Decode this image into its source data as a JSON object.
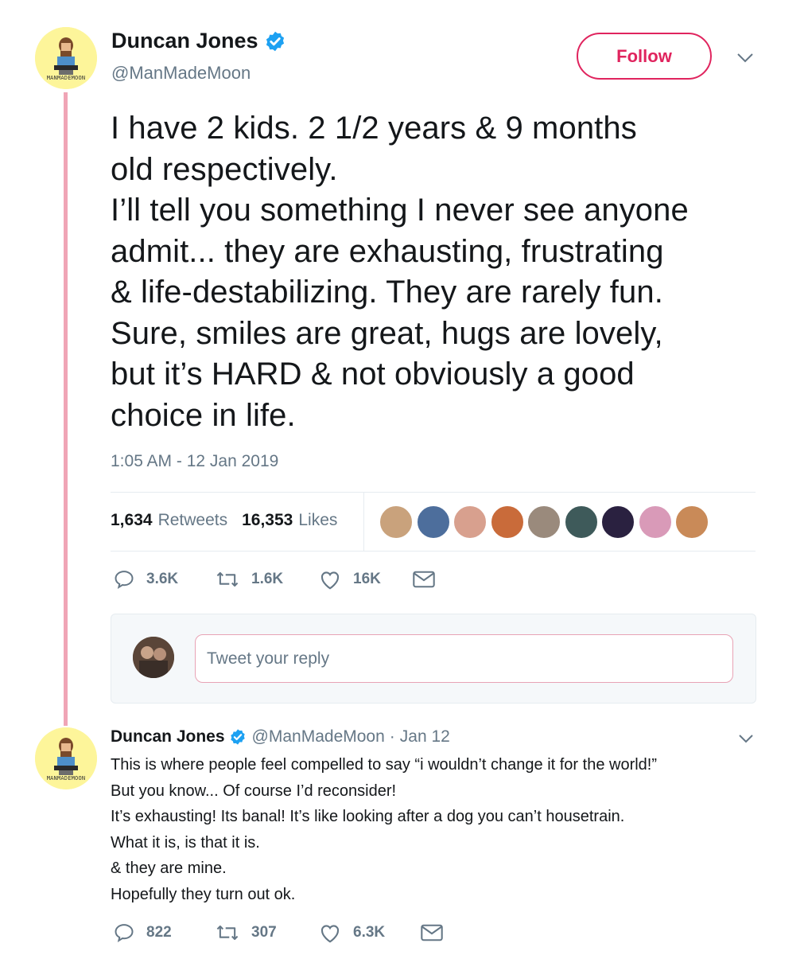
{
  "main_tweet": {
    "author_name": "Duncan Jones",
    "author_handle": "@ManMadeMoon",
    "avatar_caption": "MANMADEMOON",
    "follow_label": "Follow",
    "text": "I have 2 kids.  2 1/2 years & 9 months\nold respectively.\nI’ll tell you something I never see anyone\nadmit... they are exhausting, frustrating\n& life-destabilizing.  They are rarely fun.\nSure, smiles are great, hugs are lovely,\nbut it’s HARD & not obviously a good\nchoice in life.",
    "timestamp": "1:05 AM - 12 Jan 2019",
    "retweets_count": "1,634",
    "retweets_label": "Retweets",
    "likes_count": "16,353",
    "likes_label": "Likes",
    "likers": [
      {
        "name": "liker-1",
        "color": "#c9a27c"
      },
      {
        "name": "liker-2",
        "color": "#4d6e9c"
      },
      {
        "name": "liker-3",
        "color": "#d8a08e"
      },
      {
        "name": "liker-4",
        "color": "#c96b3a"
      },
      {
        "name": "liker-5",
        "color": "#9a8a7c"
      },
      {
        "name": "liker-6",
        "color": "#3e5a5a"
      },
      {
        "name": "liker-7",
        "color": "#2a2140"
      },
      {
        "name": "liker-8",
        "color": "#d99ab8"
      },
      {
        "name": "liker-9",
        "color": "#c98a58"
      }
    ],
    "actions": {
      "replies": "3.6K",
      "retweets": "1.6K",
      "likes": "16K"
    }
  },
  "reply_composer": {
    "placeholder": "Tweet your reply"
  },
  "reply_tweet": {
    "author_name": "Duncan Jones",
    "author_handle": "@ManMadeMoon",
    "separator": "·",
    "date": "Jan 12",
    "avatar_caption": "MANMADEMOON",
    "text": "This is where people feel compelled to say “i wouldn’t change it for the world!”\nBut you know...  Of course I’d reconsider!\nIt’s exhausting!  Its banal!  It’s like looking after a dog you can’t housetrain.\nWhat it is, is that it is.\n& they are mine.\nHopefully they turn out ok.",
    "actions": {
      "replies": "822",
      "retweets": "307",
      "likes": "6.3K"
    }
  },
  "colors": {
    "accent": "#e0245e",
    "thread_line": "#f0a5b6",
    "verified": "#1da1f2",
    "muted": "#657786"
  }
}
